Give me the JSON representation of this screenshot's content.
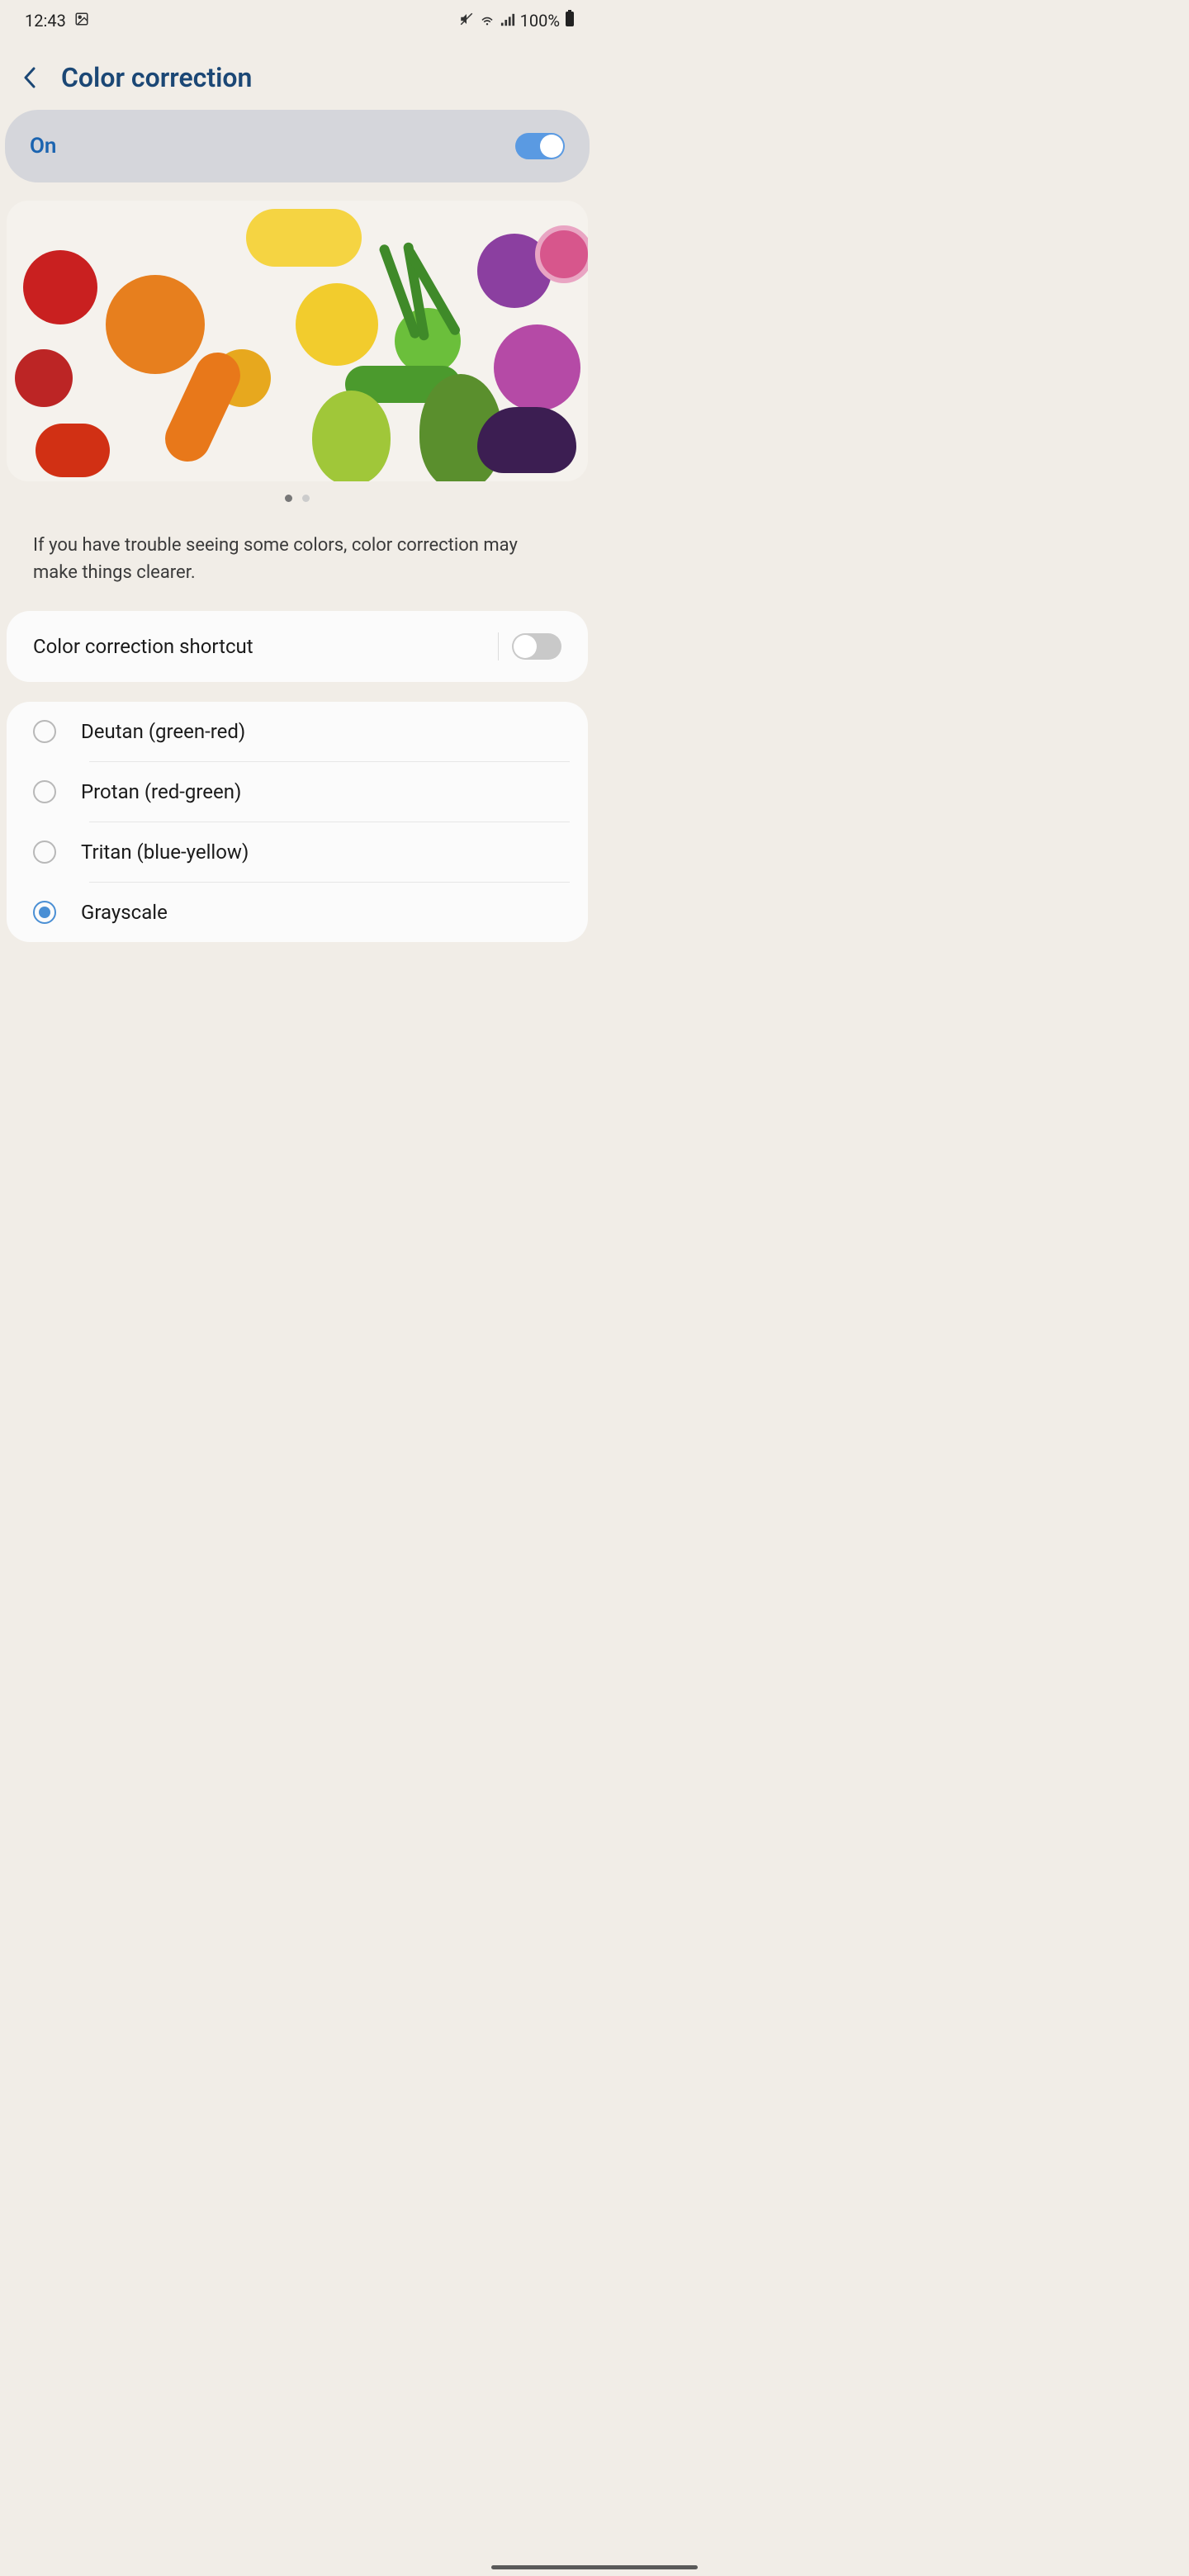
{
  "status": {
    "time": "12:43",
    "battery": "100%"
  },
  "header": {
    "title": "Color correction"
  },
  "master_toggle": {
    "label": "On",
    "enabled": true
  },
  "description": "If you have trouble seeing some colors, color correction may make things clearer.",
  "shortcut": {
    "label": "Color correction shortcut",
    "enabled": false
  },
  "modes": [
    {
      "label": "Deutan (green-red)",
      "selected": false
    },
    {
      "label": "Protan (red-green)",
      "selected": false
    },
    {
      "label": "Tritan (blue-yellow)",
      "selected": false
    },
    {
      "label": "Grayscale",
      "selected": true
    }
  ],
  "pager": {
    "count": 2,
    "active": 0
  }
}
